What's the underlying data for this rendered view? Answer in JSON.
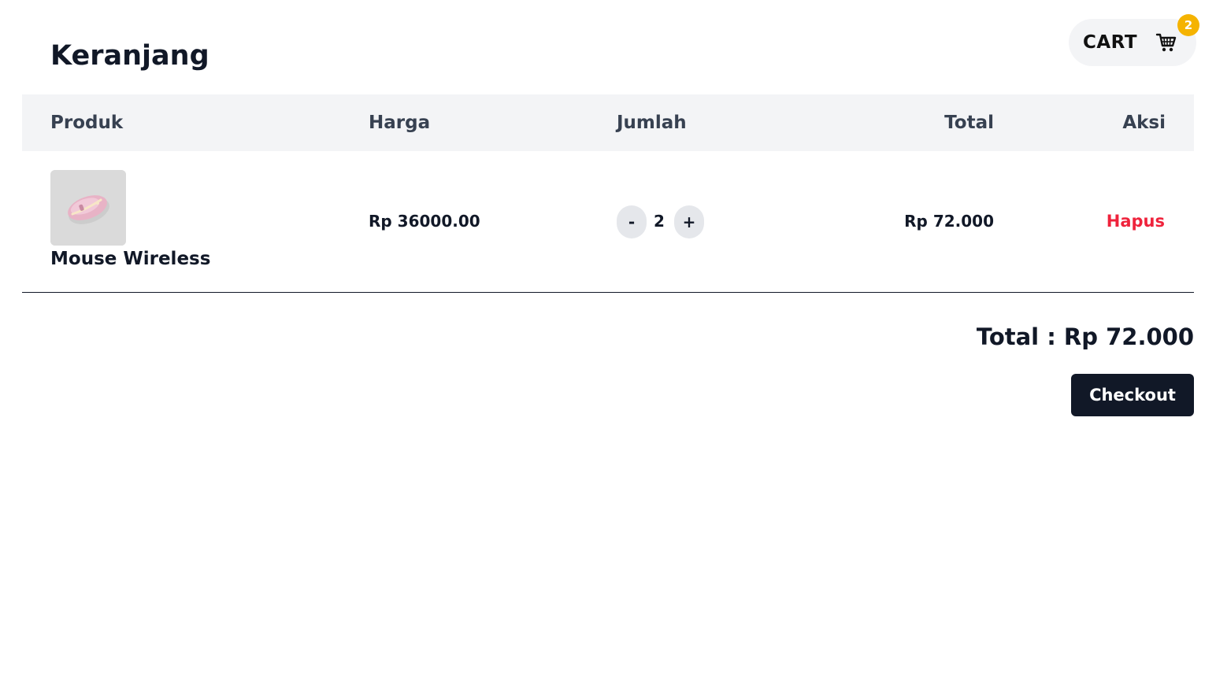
{
  "page": {
    "title": "Keranjang"
  },
  "cart_widget": {
    "label": "CART",
    "icon": "shopping-cart-icon",
    "badge_count": "2",
    "badge_color": "#f5b301"
  },
  "table": {
    "headers": {
      "product": "Produk",
      "price": "Harga",
      "quantity": "Jumlah",
      "total": "Total",
      "action": "Aksi"
    },
    "rows": [
      {
        "product_name": "Mouse Wireless",
        "image": "pink-wireless-mouse",
        "price": "Rp 36000.00",
        "decrement_label": "-",
        "quantity": "2",
        "increment_label": "+",
        "total": "Rp 72.000",
        "action_label": "Hapus"
      }
    ]
  },
  "summary": {
    "total_text": "Total : Rp 72.000",
    "checkout_label": "Checkout"
  },
  "colors": {
    "primary_dark": "#111827",
    "danger": "#ef233c",
    "header_bg": "#f3f4f6"
  }
}
